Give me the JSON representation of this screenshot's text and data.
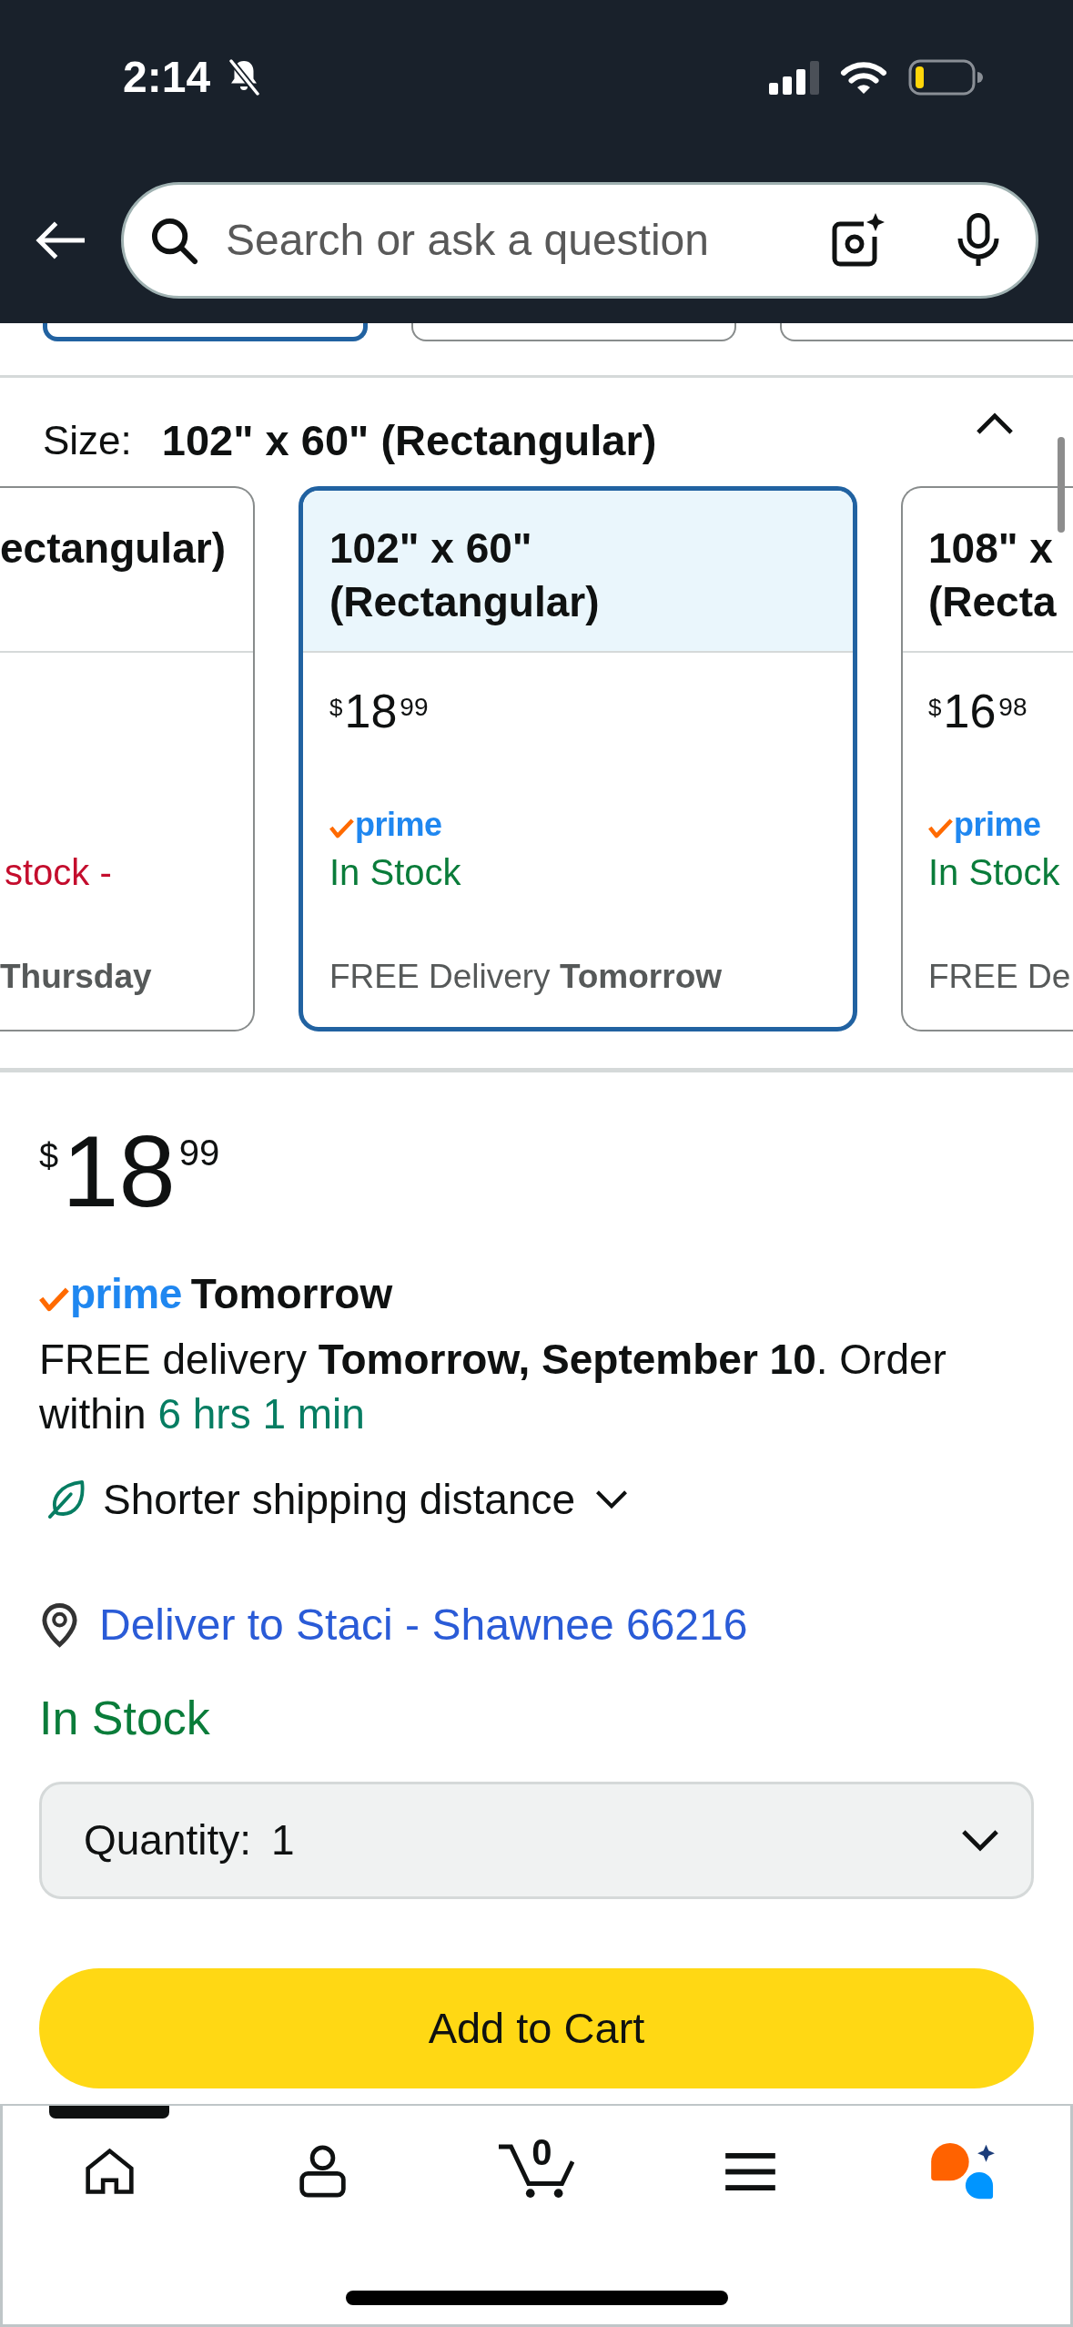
{
  "status_bar": {
    "time": "2:14"
  },
  "search": {
    "placeholder": "Search or ask a question"
  },
  "style_options": [
    {
      "selected": true
    },
    {
      "selected": false
    },
    {
      "selected": false
    }
  ],
  "size": {
    "label": "Size:",
    "value": "102\" x 60\" (Rectangular)",
    "expanded": true
  },
  "size_options": [
    {
      "name": "ectangular)",
      "selected": false,
      "availability": {
        "kind": "low",
        "text": "stock -"
      },
      "delivery": "Thursday",
      "delivery_bold": true
    },
    {
      "name": "102\" x 60\" (Rectangular)",
      "selected": true,
      "price": {
        "currency": "$",
        "whole": "18",
        "fraction": "99"
      },
      "badge": "prime",
      "availability": {
        "kind": "in",
        "text": "In Stock"
      },
      "delivery": "FREE Delivery **Tomorrow**",
      "delivery_bold": false
    },
    {
      "name": "108\" x (Recta",
      "selected": false,
      "price": {
        "currency": "$",
        "whole": "16",
        "fraction": "98"
      },
      "badge": "prime",
      "availability": {
        "kind": "in",
        "text": "In Stock"
      },
      "delivery": "FREE De",
      "delivery_bold": false
    }
  ],
  "price": {
    "currency": "$",
    "whole": "18",
    "fraction": "99"
  },
  "delivery_promise": {
    "badge": "prime",
    "day": "Tomorrow"
  },
  "delivery_message": {
    "text": "FREE delivery **Tomorrow, September 10**. Order within",
    "countdown": "6 hrs 1 min"
  },
  "sustainability": {
    "label": "Shorter shipping distance",
    "expanded": false
  },
  "deliver_to": "Deliver to Staci - Shawnee 66216",
  "stock": "In Stock",
  "quantity": {
    "label": "Quantity:",
    "value": "1"
  },
  "add_to_cart": "Add to Cart",
  "bottom_nav": [
    {
      "kind": "home",
      "selected": true
    },
    {
      "kind": "account",
      "selected": false
    },
    {
      "kind": "cart",
      "selected": false,
      "count": "0"
    },
    {
      "kind": "menu",
      "selected": false
    },
    {
      "kind": "assistant",
      "selected": false
    }
  ]
}
